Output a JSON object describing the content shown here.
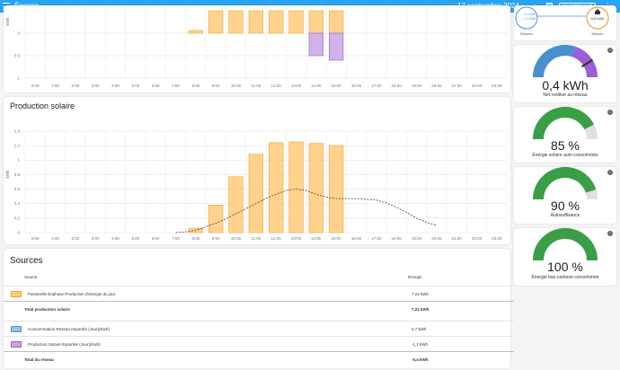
{
  "topbar": {
    "title": "Énergie",
    "date": "17 septembre 2024",
    "prev": "‹",
    "next": "›",
    "today": "MAINTENANT",
    "more": "⋮",
    "bg": "#2aa3f0"
  },
  "consumption_chart": {
    "ylabel": "kWh",
    "yticks": [
      "0",
      "0.5",
      "1"
    ],
    "hours": [
      "0:00",
      "1:00",
      "2:00",
      "3:00",
      "4:00",
      "5:00",
      "6:00",
      "7:00",
      "8:00",
      "9:00",
      "10:00",
      "11:00",
      "12:00",
      "13:00",
      "14:00",
      "15:00",
      "16:00",
      "17:00",
      "18:00",
      "19:00",
      "20:00",
      "21:00",
      "22:00",
      "23:00"
    ]
  },
  "production_chart": {
    "title": "Production solaire",
    "ylabel": "kWh",
    "yticks": [
      "0",
      "0.2",
      "0.4",
      "0.6",
      "0.8",
      "1",
      "1.2",
      "1.4"
    ],
    "hours": [
      "0:00",
      "1:00",
      "2:00",
      "3:00",
      "4:00",
      "5:00",
      "6:00",
      "7:00",
      "8:00",
      "9:00",
      "10:00",
      "11:00",
      "12:00",
      "13:00",
      "14:00",
      "15:00",
      "16:00",
      "17:00",
      "18:00",
      "19:00",
      "20:00",
      "21:00",
      "22:00",
      "23:00"
    ]
  },
  "chart_data": [
    {
      "type": "bar",
      "categories": [
        "0:00",
        "1:00",
        "2:00",
        "3:00",
        "4:00",
        "5:00",
        "6:00",
        "7:00",
        "8:00",
        "9:00",
        "10:00",
        "11:00",
        "12:00",
        "13:00",
        "14:00",
        "15:00",
        "16:00",
        "17:00",
        "18:00",
        "19:00",
        "20:00",
        "21:00",
        "22:00",
        "23:00"
      ],
      "series": [
        {
          "name": "Passerelle Enphase Production d'énergie du jour",
          "color": "#ffcb7a",
          "values": [
            0,
            0,
            0,
            0,
            0,
            0,
            0,
            0,
            0.06,
            0.5,
            0.5,
            0.5,
            0.5,
            0.5,
            0.5,
            0.5,
            0,
            0,
            0,
            0,
            0,
            0,
            0,
            0
          ]
        },
        {
          "name": "Production Solaire Exportée (Jour)(Kwh)",
          "color": "#c9a6e8",
          "values": [
            0,
            0,
            0,
            0,
            0,
            0,
            0,
            0,
            0,
            0,
            0,
            0,
            0,
            0,
            -0.5,
            -0.6,
            0,
            0,
            0,
            0,
            0,
            0,
            0,
            0
          ]
        }
      ],
      "ylabel": "kWh",
      "ylim": [
        -0.6,
        0.5
      ]
    },
    {
      "type": "bar",
      "title": "Production solaire",
      "categories": [
        "0:00",
        "1:00",
        "2:00",
        "3:00",
        "4:00",
        "5:00",
        "6:00",
        "7:00",
        "8:00",
        "9:00",
        "10:00",
        "11:00",
        "12:00",
        "13:00",
        "14:00",
        "15:00",
        "16:00",
        "17:00",
        "18:00",
        "19:00",
        "20:00",
        "21:00",
        "22:00",
        "23:00"
      ],
      "series": [
        {
          "name": "Passerelle Enphase Production d'énergie du jour",
          "color": "#ffcb7a",
          "values": [
            0,
            0,
            0,
            0,
            0,
            0,
            0,
            0,
            0.06,
            0.38,
            0.77,
            1.08,
            1.24,
            1.25,
            1.23,
            1.2,
            0,
            0,
            0,
            0,
            0,
            0,
            0,
            0
          ]
        }
      ],
      "forecast": {
        "x": [
          7.0,
          7.5,
          8.0,
          8.5,
          9.0,
          9.5,
          10.0,
          10.5,
          11.0,
          11.5,
          12.0,
          12.5,
          13.0,
          13.5,
          14.0,
          14.5,
          15.0,
          15.5,
          16.0,
          16.5,
          17.0,
          17.5,
          18.0,
          18.5,
          19.0,
          19.5,
          20.0
        ],
        "y": [
          0,
          0.01,
          0.03,
          0.08,
          0.13,
          0.19,
          0.26,
          0.33,
          0.4,
          0.47,
          0.53,
          0.58,
          0.6,
          0.58,
          0.53,
          0.49,
          0.47,
          0.47,
          0.47,
          0.46,
          0.45,
          0.41,
          0.35,
          0.28,
          0.2,
          0.14,
          0.1
        ]
      },
      "ylabel": "kWh",
      "ylim": [
        0,
        1.4
      ]
    }
  ],
  "sources": {
    "title": "Sources",
    "col_source": "Source",
    "col_energy": "Énergie",
    "rows": [
      {
        "label": "Passerelle Enphase Production d'énergie du jour",
        "value": "7,21 kWh",
        "color": "#ffcb7a",
        "border": "#f0a030",
        "total": false
      },
      {
        "label": "Total production solaire",
        "value": "7,21 kWh",
        "total": true
      },
      {
        "label": "Consommation Reseau Importée (Jour)(Kwh)",
        "value": "0,7 kWh",
        "color": "#9cc3e6",
        "border": "#5a90c8",
        "total": false
      },
      {
        "label": "Production Solaire Exportée (Jour)(Kwh)",
        "value": "-1,1 kWh",
        "color": "#c9a6e8",
        "border": "#9060c0",
        "total": false
      },
      {
        "label": "Total du réseau",
        "value": "-0,4 kWh",
        "total": true
      }
    ]
  },
  "flow": {
    "grid_label": "Réseau",
    "home_label": "Maison",
    "grid_in": "← 1,1 kWh",
    "grid_out": "→ 0,7 kWh",
    "home_value": "5,5 kWh"
  },
  "gauges": [
    {
      "value": "0,4 kWh",
      "label": "Net restitué au réseau",
      "fraction": 0.82,
      "color_left": "#4a90d0",
      "color_right": "#9b5fd8"
    },
    {
      "value": "85 %",
      "label": "Énergie solaire auto-consommée",
      "fraction": 0.85,
      "color": "#3a9e46"
    },
    {
      "value": "90 %",
      "label": "Autosuffisance",
      "fraction": 0.9,
      "color": "#3a9e46"
    },
    {
      "value": "100 %",
      "label": "Énergie bas-carbone consommée",
      "fraction": 1.0,
      "color": "#3a9e46"
    }
  ]
}
